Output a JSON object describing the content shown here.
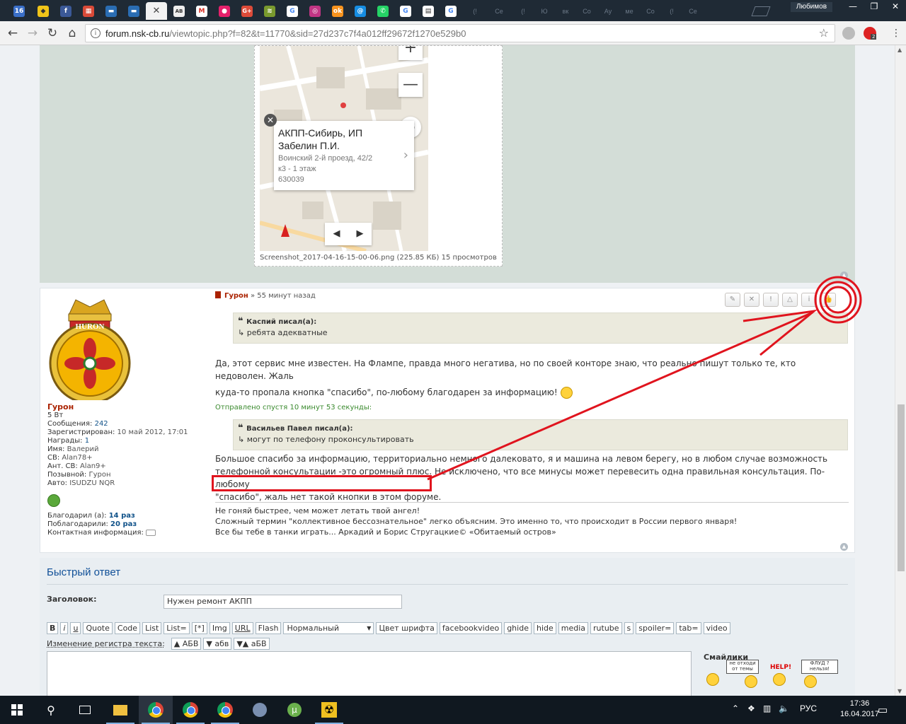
{
  "browser": {
    "profile_name": "Любимов",
    "tabs_ghost": [
      "(!",
      "Се",
      "(!",
      "Ю",
      "вк",
      "Со",
      "Ау",
      "ме",
      "Со",
      "(!",
      "Се"
    ],
    "url_domain": "forum.nsk-cb.ru",
    "url_path": "/viewtopic.php?f=82&t=11770&sid=27d237c7f4a012ff29672f1270e529b0",
    "ext_badge": "2"
  },
  "map": {
    "title": "АКПП-Сибирь, ИП Забелин П.И.",
    "address_line1": "Воинский 2-й проезд, 42/2",
    "address_line2": "к3 - 1 этаж",
    "postcode": "630039",
    "zoom_minus": "—",
    "caption": "Screenshot_2017-04-16-15-00-06.png (225.85 КБ) 15 просмотров"
  },
  "post": {
    "author": "Гурон",
    "time": " » 55 минут назад",
    "buttons": [
      "✎",
      "✕",
      "!",
      "△",
      "i",
      "👍"
    ],
    "quote1": {
      "header": "Каспий писал(а):",
      "text": "ребята адекватные"
    },
    "para1_line1": "Да, этот сервис мне известен. На Флампе, правда много негатива, но по своей конторе знаю, что реально пишут только те, кто недоволен. Жаль",
    "para1_line2": "куда-то пропала кнопка \"спасибо\", по-любому благодарен за информацию!",
    "sent_after": "Отправлено спустя 10 минут 53 секунды:",
    "quote2": {
      "header": "Васильев Павел писал(а):",
      "text": "могут по телефону проконсультировать"
    },
    "para2_line1": "Большое спасибо за информацию, территориально немного далековато, я и машина на левом берегу, но в любом случае возможность",
    "para2_line2": "телефонной консультации -это огромный плюс. Не исключено, что все минусы может перевесить одна правильная консультация. По-любому",
    "para2_line3": "\"спасибо\", жаль нет такой кнопки в этом форуме.",
    "signature": [
      "Не гоняй быстрее, чем может летать твой ангел!",
      "Сложный термин \"коллективное бессознательное\" легко объясним. Это именно то, что происходит в России первого января!",
      "Все бы тебе в танки играть... Аркадий и Борис Стругацкие© «Обитаемый остров»"
    ]
  },
  "profile": {
    "avatar_text": "HURON",
    "name": "Гурон",
    "rank": "5 Вт",
    "messages_label": "Сообщения:",
    "messages": "242",
    "registered_label": "Зарегистрирован:",
    "registered": "10 май 2012, 17:01",
    "awards_label": "Награды:",
    "awards": "1",
    "firstname_label": "Имя:",
    "firstname": "Валерий",
    "cb_label": "СВ:",
    "cb": "Alan78+",
    "ant_label": "Ант. СВ:",
    "ant": "Alan9+",
    "callsign_label": "Позывной:",
    "callsign": "Гурон",
    "auto_label": "Авто:",
    "auto": "ISUDZU NQR",
    "thanked_label": "Благодарил (а):",
    "thanked": "14 раз",
    "was_thanked_label": "Поблагодарили:",
    "was_thanked": "20 раз",
    "contact_label": "Контактная информация:"
  },
  "quick_reply": {
    "title": "Быстрый ответ",
    "subject_label": "Заголовок:",
    "subject_value": "Нужен ремонт АКПП",
    "bbcodes": [
      "B",
      "i",
      "u",
      "Quote",
      "Code",
      "List",
      "List=",
      "[*]",
      "Img",
      "URL",
      "Flash"
    ],
    "font_size": "Нормальный",
    "bbcodes2": [
      "Цвет шрифта",
      "facebookvideo",
      "ghide",
      "hide",
      "media",
      "rutube",
      "s",
      "spoiler=",
      "tab=",
      "video"
    ],
    "case_label": "Изменение регистра текста:",
    "case_buttons": [
      "▲ АБВ",
      "▼ абв",
      "▼▲ аБВ"
    ],
    "smilies_title": "Смайлики",
    "smiley_signs": [
      "не отходи от темы",
      "HELP!",
      "ФЛУД ? нельзя!"
    ]
  },
  "taskbar": {
    "lang": "РУС",
    "time": "17:36",
    "date": "16.04.2017"
  },
  "colors": {
    "annotation_red": "#e0141e",
    "link_blue": "#105289",
    "author_red": "#aa2200"
  }
}
